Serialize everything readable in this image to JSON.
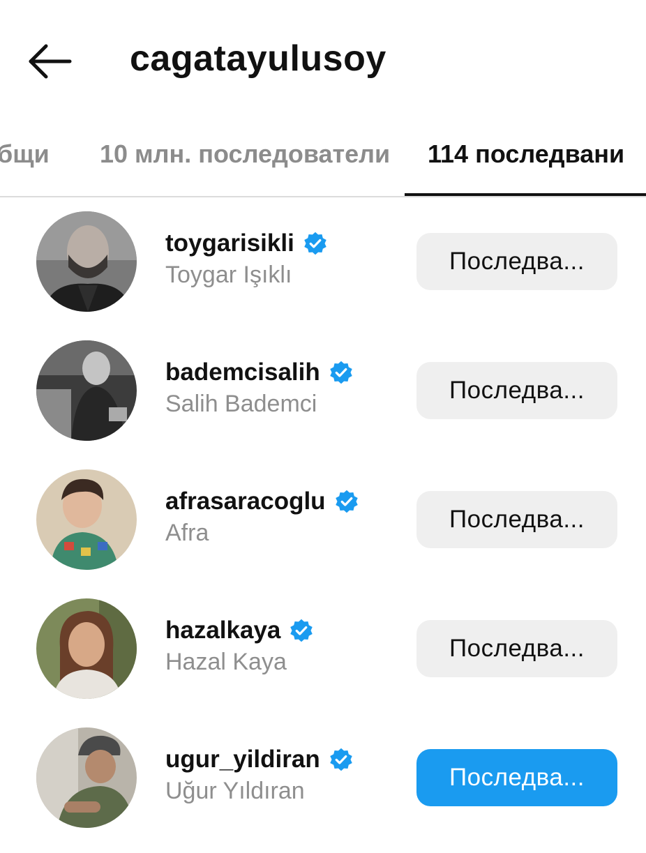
{
  "header": {
    "back_icon": "arrow-left-icon",
    "title": "cagatayulusoy"
  },
  "tabs": [
    {
      "label": "общи",
      "active": false
    },
    {
      "label": "10 млн. последователи",
      "active": false
    },
    {
      "label": "114 последвани",
      "active": true
    }
  ],
  "colors": {
    "verified_badge": "#1a9bf0",
    "primary_button": "#1a9bf0",
    "secondary_button": "#efefef",
    "muted_text": "#8e8e8e"
  },
  "accounts": [
    {
      "username": "toygarisikli",
      "full_name": "Toygar Işıklı",
      "verified": true,
      "button_label": "Последва...",
      "button_style": "secondary"
    },
    {
      "username": "bademcisalih",
      "full_name": "Salih Bademci",
      "verified": true,
      "button_label": "Последва...",
      "button_style": "secondary"
    },
    {
      "username": "afrasaracoglu",
      "full_name": "Afra",
      "verified": true,
      "button_label": "Последва...",
      "button_style": "secondary"
    },
    {
      "username": "hazalkaya",
      "full_name": "Hazal Kaya",
      "verified": true,
      "button_label": "Последва...",
      "button_style": "secondary"
    },
    {
      "username": "ugur_yildiran",
      "full_name": "Uğur Yıldıran",
      "verified": true,
      "button_label": "Последва...",
      "button_style": "primary"
    }
  ]
}
